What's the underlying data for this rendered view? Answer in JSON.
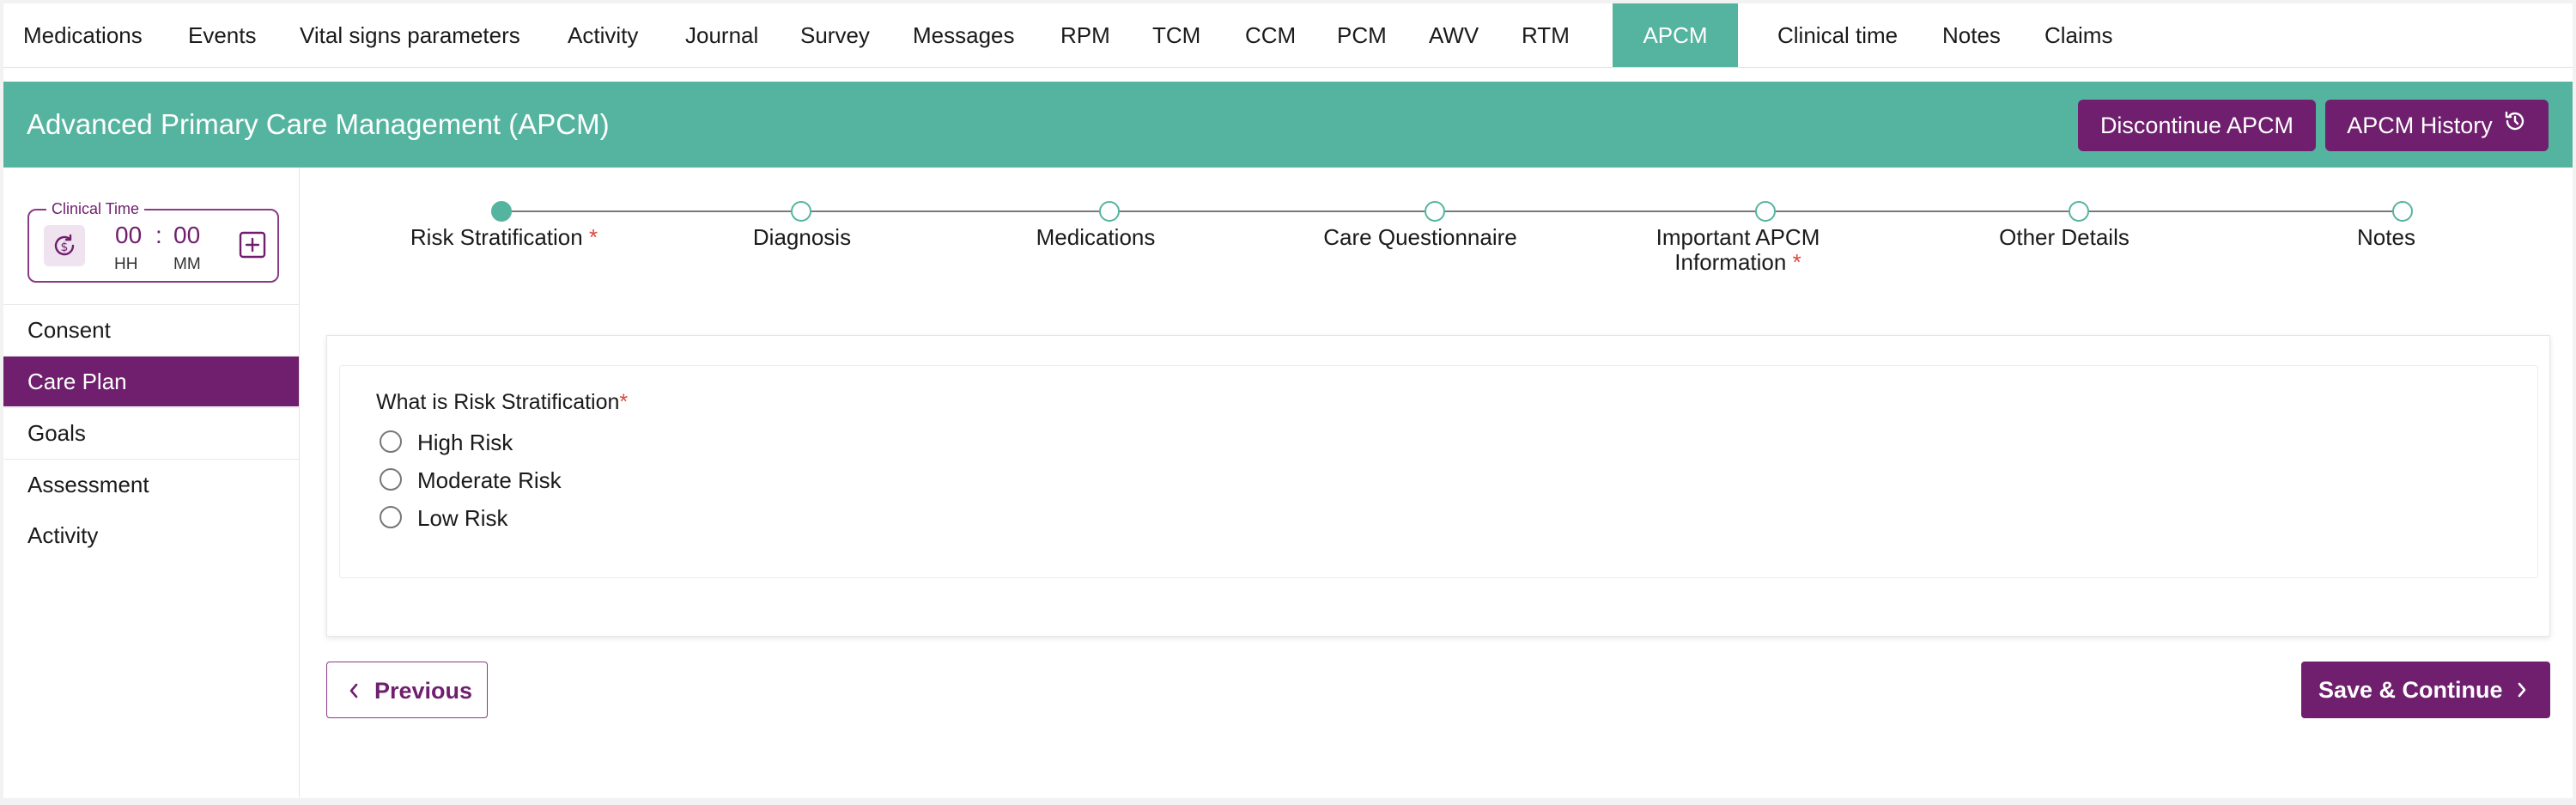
{
  "tabs": [
    "Medications",
    "Events",
    "Vital signs parameters",
    "Activity",
    "Journal",
    "Survey",
    "Messages",
    "RPM",
    "TCM",
    "CCM",
    "PCM",
    "AWV",
    "RTM",
    "APCM",
    "Clinical time",
    "Notes",
    "Claims"
  ],
  "active_tab": "APCM",
  "header": {
    "title": "Advanced Primary Care Management (APCM)",
    "discontinue_label": "Discontinue APCM",
    "history_label": "APCM History",
    "accent_color": "#55b49f",
    "brand_color": "#6f1f6d"
  },
  "clinical_time": {
    "label": "Clinical Time",
    "hours": "00",
    "separator": ":",
    "minutes": "00",
    "hours_unit": "HH",
    "minutes_unit": "MM"
  },
  "sidebar": {
    "items": [
      "Consent",
      "Care Plan",
      "Goals",
      "Assessment",
      "Activity"
    ],
    "active": "Care Plan"
  },
  "steps": [
    {
      "label": "Risk Stratification",
      "required": "*"
    },
    {
      "label": "Diagnosis",
      "required": ""
    },
    {
      "label": "Medications",
      "required": ""
    },
    {
      "label": "Care Questionnaire",
      "required": ""
    },
    {
      "label_line1": "Important APCM",
      "label_line2": "Information",
      "required": "*"
    },
    {
      "label": "Other Details",
      "required": ""
    },
    {
      "label": "Notes",
      "required": ""
    }
  ],
  "form": {
    "question": "What is Risk Stratification",
    "required_mark": "*",
    "options": [
      "High Risk",
      "Moderate Risk",
      "Low Risk"
    ]
  },
  "footer": {
    "previous_label": "Previous",
    "save_label": "Save & Continue"
  }
}
